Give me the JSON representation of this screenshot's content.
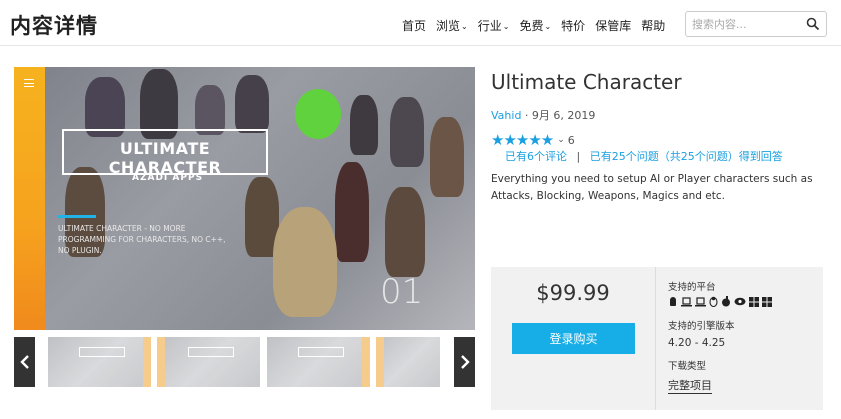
{
  "header": {
    "title": "内容详情",
    "nav": [
      {
        "label": "首页",
        "has_dropdown": false
      },
      {
        "label": "浏览",
        "has_dropdown": true
      },
      {
        "label": "行业",
        "has_dropdown": true
      },
      {
        "label": "免费",
        "has_dropdown": true
      },
      {
        "label": "特价",
        "has_dropdown": false
      },
      {
        "label": "保管库",
        "has_dropdown": false
      },
      {
        "label": "帮助",
        "has_dropdown": false
      }
    ],
    "search_placeholder": "搜索内容...",
    "search_icon": "search-icon"
  },
  "gallery": {
    "title_overlay": "ULTIMATE CHARACTER",
    "subtitle_overlay": "AZADI APPS",
    "tagline_overlay": "ULTIMATE CHARACTER - NO MORE PROGRAMMING FOR CHARACTERS, NO C++, NO PLUGIN.",
    "slide_number": "01",
    "prev_icon": "chevron-left-icon",
    "next_icon": "chevron-right-icon",
    "thumb_count": 5,
    "accent_orange": "#f6a21e",
    "accent_blue": "#21b3e6"
  },
  "product": {
    "name": "Ultimate Character",
    "author": "Vahid",
    "date": "9月 6, 2019",
    "rating_stars": 5,
    "rating_count": "6",
    "reviews_link": "已有6个评论",
    "questions_link": "已有25个问题（共25个问题）得到回答",
    "description": "Everything you need to setup AI or Player characters such as Attacks, Blocking, Weapons, Magics and etc."
  },
  "purchase": {
    "price": "$99.99",
    "buy_label": "登录购买",
    "platforms_label": "支持的平台",
    "platform_icons": [
      "android-icon",
      "laptop-icon",
      "linux-icon",
      "apple-icon",
      "apple-icon",
      "vr-eye-icon",
      "windows-icon",
      "windows-icon"
    ],
    "engine_label": "支持的引擎版本",
    "engine_value": "4.20 - 4.25",
    "download_label": "下载类型",
    "download_value": "完整项目",
    "button_color": "#17aee8"
  }
}
